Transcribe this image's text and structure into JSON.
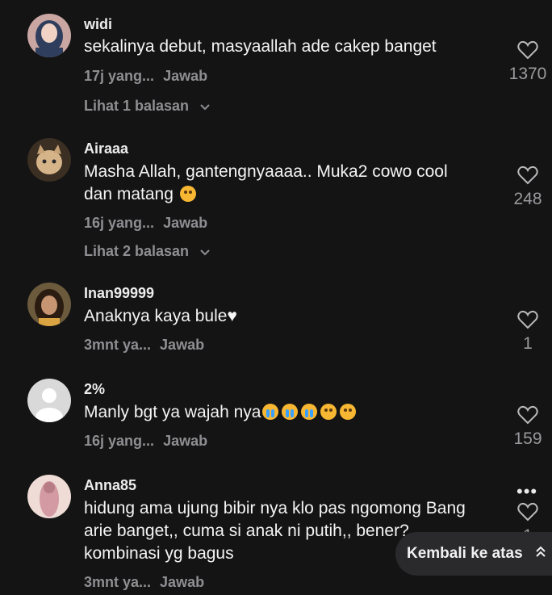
{
  "comments": [
    {
      "username": "widi",
      "text": "sekalinya debut, masyaallah ade cakep banget",
      "time": "17j yang...",
      "reply_label": "Jawab",
      "likes": "1370",
      "replies_label": "Lihat 1 balasan"
    },
    {
      "username": "Airaaa",
      "text_line1": "Masha Allah, gantengnyaaaa.. Muka2 cowo cool",
      "text_line2": "dan matang",
      "time": "16j yang...",
      "reply_label": "Jawab",
      "likes": "248",
      "replies_label": "Lihat 2 balasan"
    },
    {
      "username": "Inan99999",
      "text": "Anaknya kaya bule♥",
      "time": "3mnt ya...",
      "reply_label": "Jawab",
      "likes": "1"
    },
    {
      "username": "2%",
      "text": "Manly bgt ya wajah nya",
      "time": "16j yang...",
      "reply_label": "Jawab",
      "likes": "159"
    },
    {
      "username": "Anna85",
      "text_line1": "hidung ama ujung bibir nya klo pas ngomong Bang",
      "text_line2": "arie banget,, cuma si anak ni putih,, bener?",
      "text_line3": "kombinasi yg bagus",
      "time": "3mnt ya...",
      "reply_label": "Jawab",
      "likes": "1"
    }
  ],
  "back_to_top_label": "Kembali ke atas",
  "more_label": "•••"
}
